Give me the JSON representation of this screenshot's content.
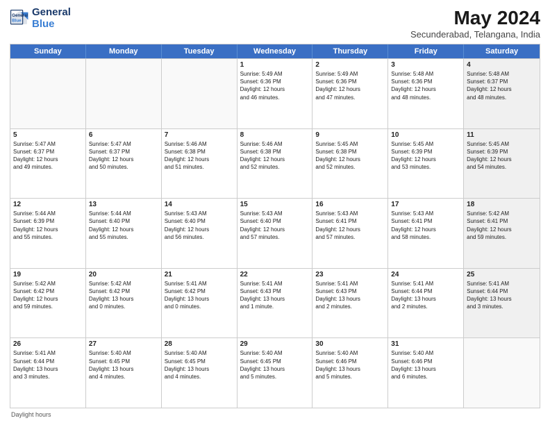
{
  "header": {
    "logo_line1": "General",
    "logo_line2": "Blue",
    "title": "May 2024",
    "subtitle": "Secunderabad, Telangana, India"
  },
  "days_of_week": [
    "Sunday",
    "Monday",
    "Tuesday",
    "Wednesday",
    "Thursday",
    "Friday",
    "Saturday"
  ],
  "footer_text": "Daylight hours",
  "rows": [
    [
      {
        "day": "",
        "info": "",
        "empty": true
      },
      {
        "day": "",
        "info": "",
        "empty": true
      },
      {
        "day": "",
        "info": "",
        "empty": true
      },
      {
        "day": "1",
        "info": "Sunrise: 5:49 AM\nSunset: 6:36 PM\nDaylight: 12 hours\nand 46 minutes."
      },
      {
        "day": "2",
        "info": "Sunrise: 5:49 AM\nSunset: 6:36 PM\nDaylight: 12 hours\nand 47 minutes."
      },
      {
        "day": "3",
        "info": "Sunrise: 5:48 AM\nSunset: 6:36 PM\nDaylight: 12 hours\nand 48 minutes."
      },
      {
        "day": "4",
        "info": "Sunrise: 5:48 AM\nSunset: 6:37 PM\nDaylight: 12 hours\nand 48 minutes.",
        "shaded": true
      }
    ],
    [
      {
        "day": "5",
        "info": "Sunrise: 5:47 AM\nSunset: 6:37 PM\nDaylight: 12 hours\nand 49 minutes."
      },
      {
        "day": "6",
        "info": "Sunrise: 5:47 AM\nSunset: 6:37 PM\nDaylight: 12 hours\nand 50 minutes."
      },
      {
        "day": "7",
        "info": "Sunrise: 5:46 AM\nSunset: 6:38 PM\nDaylight: 12 hours\nand 51 minutes."
      },
      {
        "day": "8",
        "info": "Sunrise: 5:46 AM\nSunset: 6:38 PM\nDaylight: 12 hours\nand 52 minutes."
      },
      {
        "day": "9",
        "info": "Sunrise: 5:45 AM\nSunset: 6:38 PM\nDaylight: 12 hours\nand 52 minutes."
      },
      {
        "day": "10",
        "info": "Sunrise: 5:45 AM\nSunset: 6:39 PM\nDaylight: 12 hours\nand 53 minutes."
      },
      {
        "day": "11",
        "info": "Sunrise: 5:45 AM\nSunset: 6:39 PM\nDaylight: 12 hours\nand 54 minutes.",
        "shaded": true
      }
    ],
    [
      {
        "day": "12",
        "info": "Sunrise: 5:44 AM\nSunset: 6:39 PM\nDaylight: 12 hours\nand 55 minutes."
      },
      {
        "day": "13",
        "info": "Sunrise: 5:44 AM\nSunset: 6:40 PM\nDaylight: 12 hours\nand 55 minutes."
      },
      {
        "day": "14",
        "info": "Sunrise: 5:43 AM\nSunset: 6:40 PM\nDaylight: 12 hours\nand 56 minutes."
      },
      {
        "day": "15",
        "info": "Sunrise: 5:43 AM\nSunset: 6:40 PM\nDaylight: 12 hours\nand 57 minutes."
      },
      {
        "day": "16",
        "info": "Sunrise: 5:43 AM\nSunset: 6:41 PM\nDaylight: 12 hours\nand 57 minutes."
      },
      {
        "day": "17",
        "info": "Sunrise: 5:43 AM\nSunset: 6:41 PM\nDaylight: 12 hours\nand 58 minutes."
      },
      {
        "day": "18",
        "info": "Sunrise: 5:42 AM\nSunset: 6:41 PM\nDaylight: 12 hours\nand 59 minutes.",
        "shaded": true
      }
    ],
    [
      {
        "day": "19",
        "info": "Sunrise: 5:42 AM\nSunset: 6:42 PM\nDaylight: 12 hours\nand 59 minutes."
      },
      {
        "day": "20",
        "info": "Sunrise: 5:42 AM\nSunset: 6:42 PM\nDaylight: 13 hours\nand 0 minutes."
      },
      {
        "day": "21",
        "info": "Sunrise: 5:41 AM\nSunset: 6:42 PM\nDaylight: 13 hours\nand 0 minutes."
      },
      {
        "day": "22",
        "info": "Sunrise: 5:41 AM\nSunset: 6:43 PM\nDaylight: 13 hours\nand 1 minute."
      },
      {
        "day": "23",
        "info": "Sunrise: 5:41 AM\nSunset: 6:43 PM\nDaylight: 13 hours\nand 2 minutes."
      },
      {
        "day": "24",
        "info": "Sunrise: 5:41 AM\nSunset: 6:44 PM\nDaylight: 13 hours\nand 2 minutes."
      },
      {
        "day": "25",
        "info": "Sunrise: 5:41 AM\nSunset: 6:44 PM\nDaylight: 13 hours\nand 3 minutes.",
        "shaded": true
      }
    ],
    [
      {
        "day": "26",
        "info": "Sunrise: 5:41 AM\nSunset: 6:44 PM\nDaylight: 13 hours\nand 3 minutes."
      },
      {
        "day": "27",
        "info": "Sunrise: 5:40 AM\nSunset: 6:45 PM\nDaylight: 13 hours\nand 4 minutes."
      },
      {
        "day": "28",
        "info": "Sunrise: 5:40 AM\nSunset: 6:45 PM\nDaylight: 13 hours\nand 4 minutes."
      },
      {
        "day": "29",
        "info": "Sunrise: 5:40 AM\nSunset: 6:45 PM\nDaylight: 13 hours\nand 5 minutes."
      },
      {
        "day": "30",
        "info": "Sunrise: 5:40 AM\nSunset: 6:46 PM\nDaylight: 13 hours\nand 5 minutes."
      },
      {
        "day": "31",
        "info": "Sunrise: 5:40 AM\nSunset: 6:46 PM\nDaylight: 13 hours\nand 6 minutes."
      },
      {
        "day": "",
        "info": "",
        "empty": true
      }
    ]
  ]
}
